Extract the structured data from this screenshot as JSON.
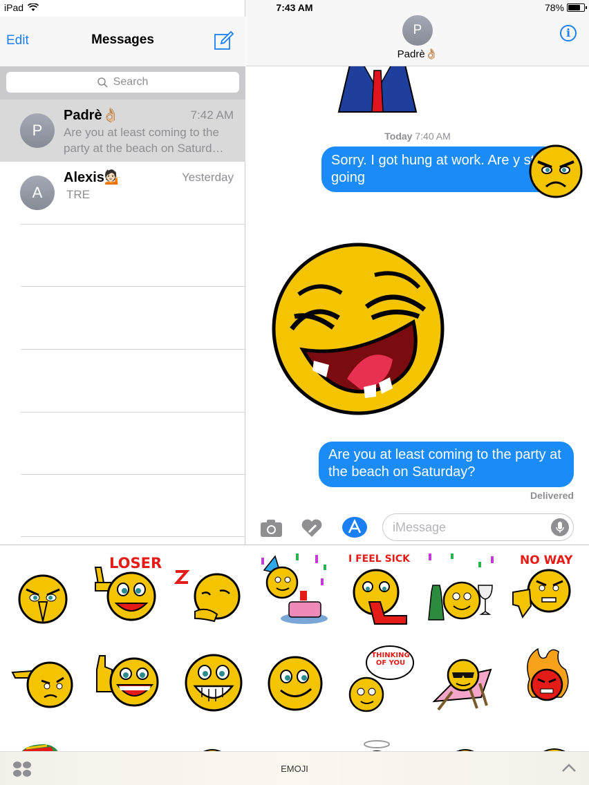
{
  "status": {
    "device": "iPad",
    "time": "7:43 AM",
    "battery": "78%"
  },
  "sidebar": {
    "edit_label": "Edit",
    "title": "Messages",
    "search_placeholder": "Search",
    "conversations": [
      {
        "initial": "P",
        "name": "Padrè👌🏼",
        "time": "7:42 AM",
        "preview": "Are you at least coming to the party at the beach on Saturd…"
      },
      {
        "initial": "A",
        "name": "Alexis💁🏻",
        "time": "Yesterday",
        "preview": "TRE"
      }
    ]
  },
  "chat": {
    "contact_initial": "P",
    "contact_name": "Padrè👌🏼",
    "timestamp_day": "Today",
    "timestamp_time": "7:40 AM",
    "messages": [
      {
        "text": "Sorry.  I got hung at work. Are y still going"
      },
      {
        "text": "Are you at least coming to the party at the beach on Saturday?"
      }
    ],
    "delivered_label": "Delivered",
    "input_placeholder": "iMessage"
  },
  "tray": {
    "label": "EMOJI",
    "sticker_captions": [
      "LOSER",
      "I FEEL SICK",
      "NO WAY",
      "THINKING OF YOU"
    ]
  },
  "colors": {
    "accent": "#1a7ef7",
    "bubble": "#1b8bf8",
    "sticker_yellow": "#f5c400"
  }
}
